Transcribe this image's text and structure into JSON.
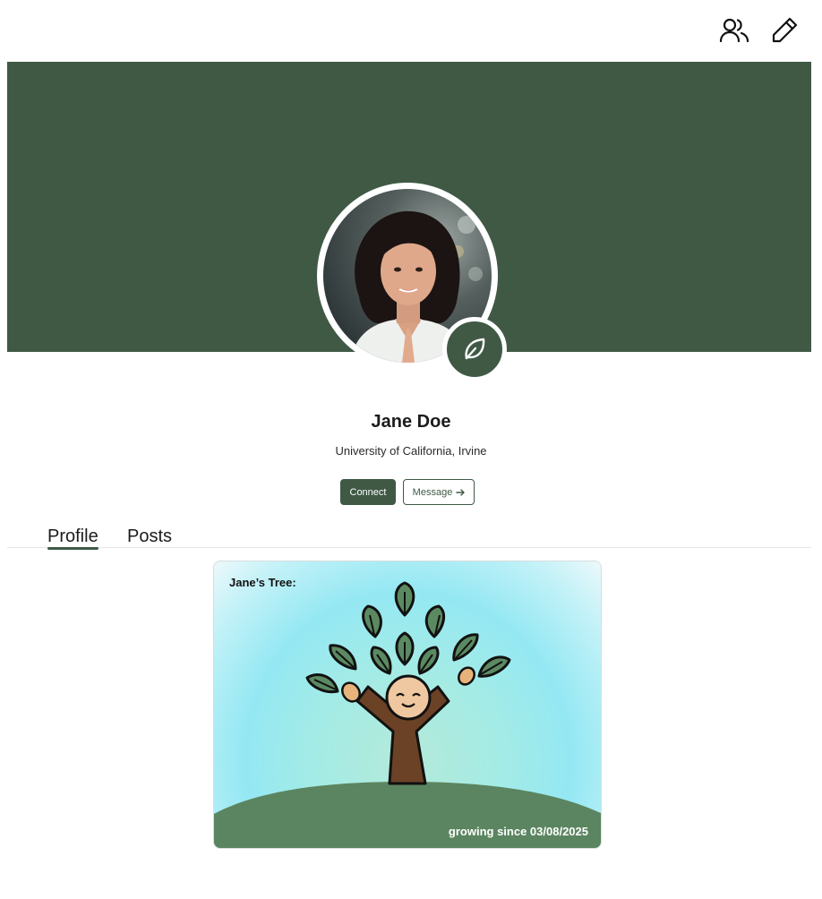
{
  "header": {
    "icons": [
      "friends-icon",
      "edit-icon"
    ]
  },
  "profile": {
    "name": "Jane Doe",
    "school": "University of California, Irvine",
    "badge_icon": "leaf-icon",
    "connect_label": "Connect",
    "message_label": "Message",
    "message_icon": "arrow-right-icon"
  },
  "tabs": [
    {
      "label": "Profile",
      "active": true
    },
    {
      "label": "Posts",
      "active": false
    }
  ],
  "tree_card": {
    "title": "Jane’s Tree:",
    "since": "growing since 03/08/2025"
  },
  "colors": {
    "brand_green": "#3f5945",
    "hill_green": "#5b8560",
    "leaf_green": "#5b8a62",
    "trunk_brown": "#6b4226"
  }
}
